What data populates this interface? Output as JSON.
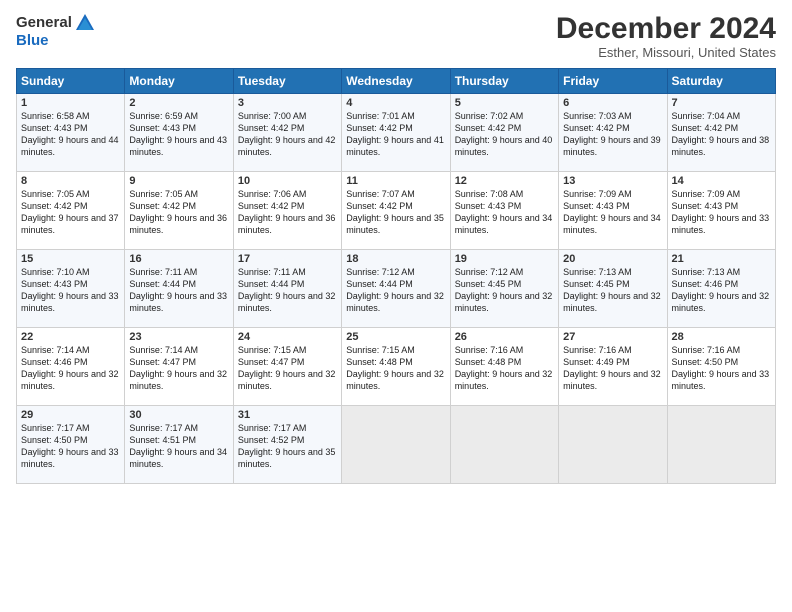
{
  "header": {
    "logo_line1": "General",
    "logo_line2": "Blue",
    "month": "December 2024",
    "location": "Esther, Missouri, United States"
  },
  "weekdays": [
    "Sunday",
    "Monday",
    "Tuesday",
    "Wednesday",
    "Thursday",
    "Friday",
    "Saturday"
  ],
  "weeks": [
    [
      {
        "day": "1",
        "sunrise": "6:58 AM",
        "sunset": "4:43 PM",
        "daylight": "9 hours and 44 minutes."
      },
      {
        "day": "2",
        "sunrise": "6:59 AM",
        "sunset": "4:43 PM",
        "daylight": "9 hours and 43 minutes."
      },
      {
        "day": "3",
        "sunrise": "7:00 AM",
        "sunset": "4:42 PM",
        "daylight": "9 hours and 42 minutes."
      },
      {
        "day": "4",
        "sunrise": "7:01 AM",
        "sunset": "4:42 PM",
        "daylight": "9 hours and 41 minutes."
      },
      {
        "day": "5",
        "sunrise": "7:02 AM",
        "sunset": "4:42 PM",
        "daylight": "9 hours and 40 minutes."
      },
      {
        "day": "6",
        "sunrise": "7:03 AM",
        "sunset": "4:42 PM",
        "daylight": "9 hours and 39 minutes."
      },
      {
        "day": "7",
        "sunrise": "7:04 AM",
        "sunset": "4:42 PM",
        "daylight": "9 hours and 38 minutes."
      }
    ],
    [
      {
        "day": "8",
        "sunrise": "7:05 AM",
        "sunset": "4:42 PM",
        "daylight": "9 hours and 37 minutes."
      },
      {
        "day": "9",
        "sunrise": "7:05 AM",
        "sunset": "4:42 PM",
        "daylight": "9 hours and 36 minutes."
      },
      {
        "day": "10",
        "sunrise": "7:06 AM",
        "sunset": "4:42 PM",
        "daylight": "9 hours and 36 minutes."
      },
      {
        "day": "11",
        "sunrise": "7:07 AM",
        "sunset": "4:42 PM",
        "daylight": "9 hours and 35 minutes."
      },
      {
        "day": "12",
        "sunrise": "7:08 AM",
        "sunset": "4:43 PM",
        "daylight": "9 hours and 34 minutes."
      },
      {
        "day": "13",
        "sunrise": "7:09 AM",
        "sunset": "4:43 PM",
        "daylight": "9 hours and 34 minutes."
      },
      {
        "day": "14",
        "sunrise": "7:09 AM",
        "sunset": "4:43 PM",
        "daylight": "9 hours and 33 minutes."
      }
    ],
    [
      {
        "day": "15",
        "sunrise": "7:10 AM",
        "sunset": "4:43 PM",
        "daylight": "9 hours and 33 minutes."
      },
      {
        "day": "16",
        "sunrise": "7:11 AM",
        "sunset": "4:44 PM",
        "daylight": "9 hours and 33 minutes."
      },
      {
        "day": "17",
        "sunrise": "7:11 AM",
        "sunset": "4:44 PM",
        "daylight": "9 hours and 32 minutes."
      },
      {
        "day": "18",
        "sunrise": "7:12 AM",
        "sunset": "4:44 PM",
        "daylight": "9 hours and 32 minutes."
      },
      {
        "day": "19",
        "sunrise": "7:12 AM",
        "sunset": "4:45 PM",
        "daylight": "9 hours and 32 minutes."
      },
      {
        "day": "20",
        "sunrise": "7:13 AM",
        "sunset": "4:45 PM",
        "daylight": "9 hours and 32 minutes."
      },
      {
        "day": "21",
        "sunrise": "7:13 AM",
        "sunset": "4:46 PM",
        "daylight": "9 hours and 32 minutes."
      }
    ],
    [
      {
        "day": "22",
        "sunrise": "7:14 AM",
        "sunset": "4:46 PM",
        "daylight": "9 hours and 32 minutes."
      },
      {
        "day": "23",
        "sunrise": "7:14 AM",
        "sunset": "4:47 PM",
        "daylight": "9 hours and 32 minutes."
      },
      {
        "day": "24",
        "sunrise": "7:15 AM",
        "sunset": "4:47 PM",
        "daylight": "9 hours and 32 minutes."
      },
      {
        "day": "25",
        "sunrise": "7:15 AM",
        "sunset": "4:48 PM",
        "daylight": "9 hours and 32 minutes."
      },
      {
        "day": "26",
        "sunrise": "7:16 AM",
        "sunset": "4:48 PM",
        "daylight": "9 hours and 32 minutes."
      },
      {
        "day": "27",
        "sunrise": "7:16 AM",
        "sunset": "4:49 PM",
        "daylight": "9 hours and 32 minutes."
      },
      {
        "day": "28",
        "sunrise": "7:16 AM",
        "sunset": "4:50 PM",
        "daylight": "9 hours and 33 minutes."
      }
    ],
    [
      {
        "day": "29",
        "sunrise": "7:17 AM",
        "sunset": "4:50 PM",
        "daylight": "9 hours and 33 minutes."
      },
      {
        "day": "30",
        "sunrise": "7:17 AM",
        "sunset": "4:51 PM",
        "daylight": "9 hours and 34 minutes."
      },
      {
        "day": "31",
        "sunrise": "7:17 AM",
        "sunset": "4:52 PM",
        "daylight": "9 hours and 35 minutes."
      },
      null,
      null,
      null,
      null
    ]
  ]
}
